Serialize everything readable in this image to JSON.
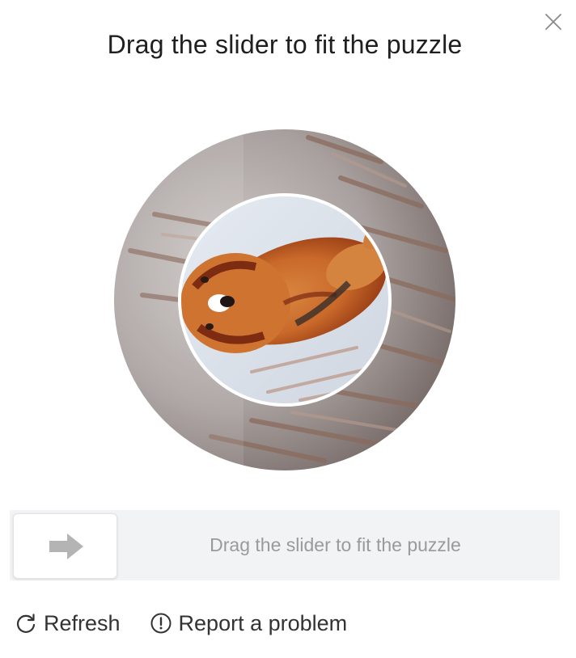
{
  "dialog": {
    "title": "Drag the slider to fit the puzzle",
    "close_icon": "close-icon"
  },
  "puzzle": {
    "image_description_icon": "rotated-puzzle-image",
    "outer_ring_colors": [
      "#9a9495",
      "#c9c4c2",
      "#7d6f6c"
    ],
    "inner_circle_colors": [
      "#d9e0ea",
      "#c96a2a",
      "#7a2a12"
    ],
    "inner_border_color": "#ffffff"
  },
  "slider": {
    "hint": "Drag the slider to fit the puzzle",
    "handle_icon": "arrow-right-icon",
    "track_color": "#f2f3f5",
    "handle_color": "#ffffff",
    "arrow_color": "#b4b4b4",
    "value": 0
  },
  "footer": {
    "refresh_label": "Refresh",
    "refresh_icon": "refresh-icon",
    "report_label": "Report a problem",
    "report_icon": "alert-circle-icon"
  }
}
